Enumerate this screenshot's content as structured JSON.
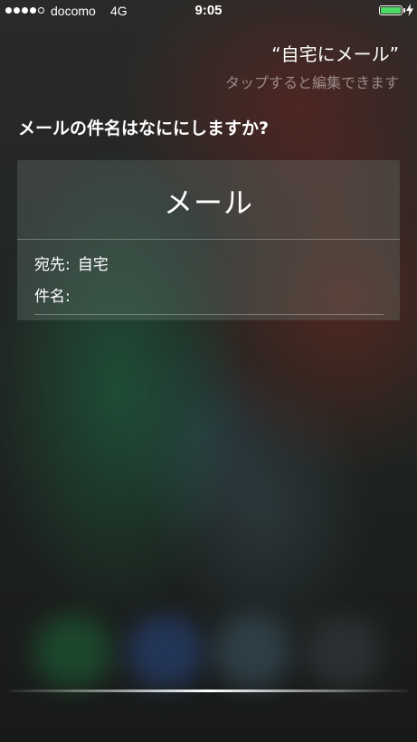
{
  "status_bar": {
    "signal_bars": 5,
    "signal_filled": 4,
    "carrier": "docomo",
    "network": "4G",
    "time": "9:05",
    "battery_level": 1.0,
    "battery_color": "#4cd964",
    "charging_icon": "bolt-icon"
  },
  "siri": {
    "utterance": "“自宅にメール”",
    "edit_hint": "タップすると編集できます",
    "question": "メールの件名はなににしますか?"
  },
  "mail_card": {
    "title": "メール",
    "to_label": "宛先:",
    "to_value": "自宅",
    "subject_label": "件名:",
    "subject_value": ""
  }
}
